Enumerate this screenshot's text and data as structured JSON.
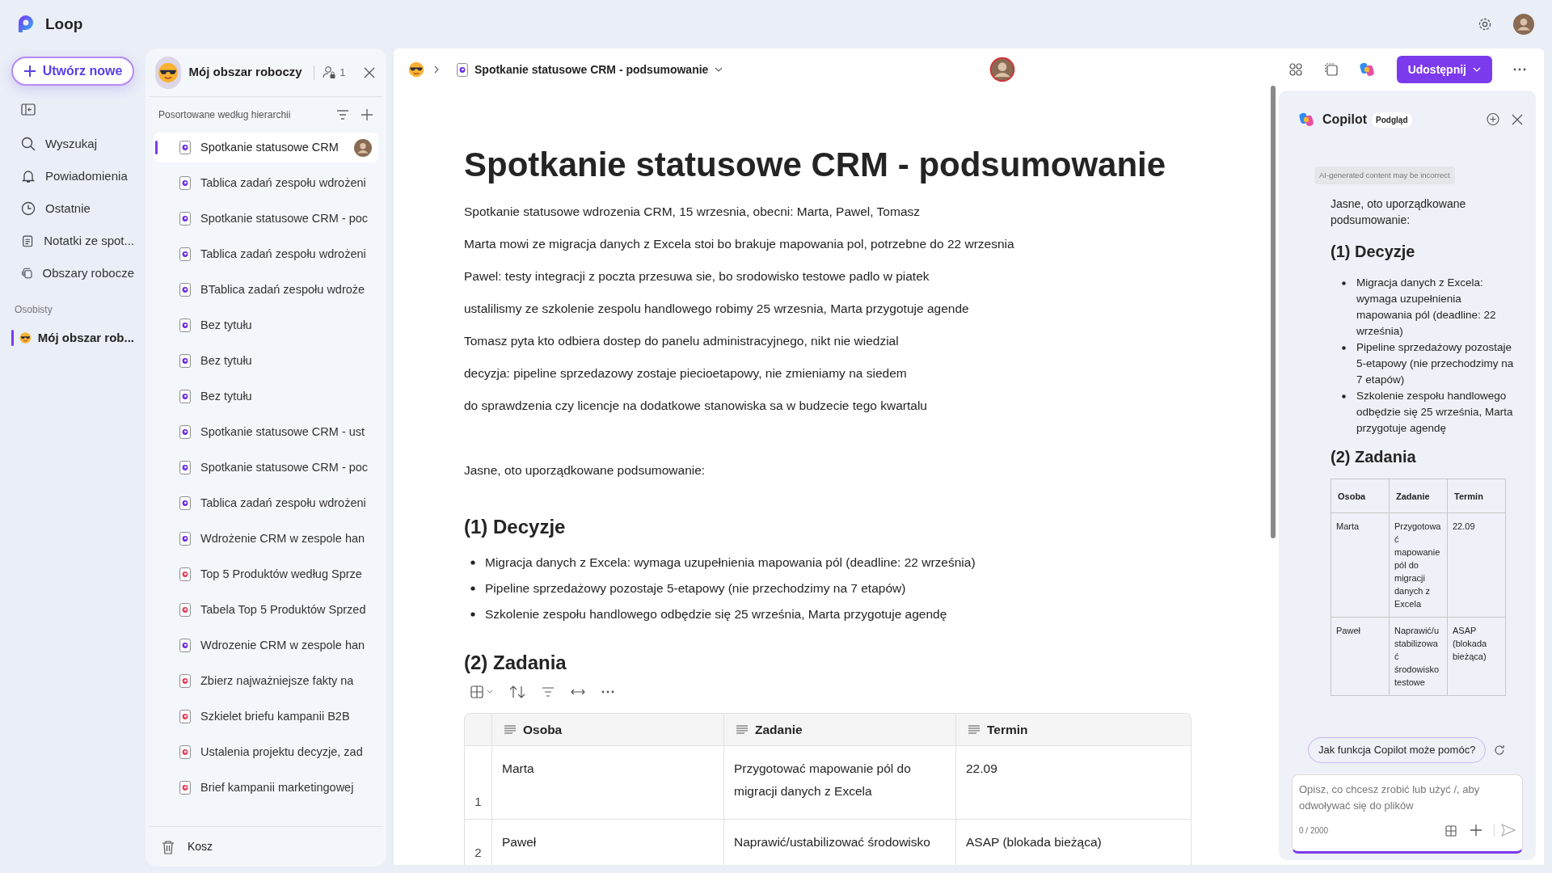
{
  "app": {
    "name": "Loop"
  },
  "create_button": "Utwórz nowe",
  "nav": [
    {
      "label": "Wyszukaj",
      "kind": "search"
    },
    {
      "label": "Powiadomienia",
      "kind": "bell"
    },
    {
      "label": "Ostatnie",
      "kind": "clock"
    },
    {
      "label": "Notatki ze spot...",
      "kind": "notes"
    },
    {
      "label": "Obszary robocze",
      "kind": "workspaces"
    }
  ],
  "section_label": "Osobisty",
  "workspaces": [
    {
      "label": "Mój obszar rob...",
      "selected": true
    }
  ],
  "sidebar": {
    "title": "Mój obszar roboczy",
    "member_count": "1",
    "sort_label": "Posortowane według hierarchii",
    "trash": "Kosz",
    "items": [
      {
        "label": "Spotkanie statusowe CRM",
        "kind": "loop",
        "selected": true
      },
      {
        "label": "Tablica zadań zespołu wdrożeni",
        "kind": "loop",
        "selected": false
      },
      {
        "label": "Spotkanie statusowe CRM - poc",
        "kind": "loop",
        "selected": false
      },
      {
        "label": "Tablica zadań zespołu wdrożeni",
        "kind": "loop",
        "selected": false
      },
      {
        "label": "BTablica zadań zespołu wdroże",
        "kind": "loop",
        "selected": false
      },
      {
        "label": "Bez tytułu",
        "kind": "loop",
        "selected": false
      },
      {
        "label": "Bez tytułu",
        "kind": "loop",
        "selected": false
      },
      {
        "label": "Bez tytułu",
        "kind": "loop",
        "selected": false
      },
      {
        "label": "Spotkanie statusowe CRM - ust",
        "kind": "loop",
        "selected": false
      },
      {
        "label": "Spotkanie statusowe CRM - poc",
        "kind": "loop",
        "selected": false
      },
      {
        "label": "Tablica zadań zespołu wdrożeni",
        "kind": "loop",
        "selected": false
      },
      {
        "label": "Wdrożenie CRM w zespole han",
        "kind": "loop",
        "selected": false
      },
      {
        "label": "Top 5 Produktów według Sprze",
        "kind": "page",
        "selected": false
      },
      {
        "label": "Tabela Top 5 Produktów Sprzed",
        "kind": "page",
        "selected": false
      },
      {
        "label": "Wdrozenie CRM w zespole han",
        "kind": "loop",
        "selected": false
      },
      {
        "label": "Zbierz najważniejsze fakty na",
        "kind": "page",
        "selected": false
      },
      {
        "label": "Szkielet briefu kampanii B2B",
        "kind": "page",
        "selected": false
      },
      {
        "label": "Ustalenia projektu decyzje, zad",
        "kind": "page",
        "selected": false
      },
      {
        "label": "Brief kampanii marketingowej",
        "kind": "page",
        "selected": false
      }
    ]
  },
  "document": {
    "breadcrumb": "Spotkanie statusowe CRM - podsumowanie",
    "share_button": "Udostępnij",
    "title": "Spotkanie statusowe CRM - podsumowanie",
    "paragraphs": [
      "Spotkanie statusowe wdrozenia CRM, 15 wrzesnia, obecni: Marta, Pawel, Tomasz",
      "Marta mowi ze migracja danych z Excela stoi bo brakuje mapowania pol, potrzebne do 22 wrzesnia",
      "Pawel: testy integracji z poczta przesuwa sie, bo srodowisko testowe padlo w piatek",
      "ustalilismy ze szkolenie zespolu handlowego robimy 25 wrzesnia, Marta przygotuje agende",
      "Tomasz pyta kto odbiera dostep do panelu administracyjnego, nikt nie wiedzial",
      "decyzja: pipeline sprzedazowy zostaje piecioetapowy, nie zmieniamy na siedem",
      "do sprawdzenia czy licencje na dodatkowe stanowiska sa w budzecie tego kwartalu"
    ],
    "summary_intro": "Jasne, oto uporządkowane podsumowanie:",
    "decisions": {
      "heading": "(1) Decyzje",
      "bullets": [
        "Migracja danych z Excela: wymaga uzupełnienia mapowania pól (deadline: 22 września)",
        "Pipeline sprzedażowy pozostaje 5-etapowy (nie przechodzimy na 7 etapów)",
        "Szkolenie zespołu handlowego odbędzie się 25 września, Marta przygotuje agendę"
      ]
    },
    "tasks": {
      "heading": "(2) Zadania",
      "columns": [
        "Osoba",
        "Zadanie",
        "Termin"
      ],
      "rows": [
        {
          "number": "1",
          "cells": [
            "Marta",
            "Przygotować mapowanie pól do migracji danych z Excela",
            "22.09"
          ]
        },
        {
          "number": "2",
          "cells": [
            "Paweł",
            "Naprawić/ustabilizować środowisko",
            "ASAP (blokada bieżąca)"
          ]
        }
      ]
    }
  },
  "copilot": {
    "title": "Copilot",
    "badge": "Podgląd",
    "disclaimer": "AI-generated content may be incorrect",
    "intro": "Jasne, oto uporządkowane podsumowanie:",
    "decisions": {
      "heading": "(1) Decyzje",
      "bullets": [
        "Migracja danych z Excela: wymaga uzupełnienia mapowania pól (deadline: 22 września)",
        "Pipeline sprzedażowy pozostaje 5-etapowy (nie przechodzimy na 7 etapów)",
        "Szkolenie zespołu handlowego odbędzie się 25 września, Marta przygotuje agendę"
      ]
    },
    "tasks": {
      "heading": "(2) Zadania",
      "columns": [
        "Osoba",
        "Zadanie",
        "Termin"
      ],
      "rows": [
        [
          "Marta",
          "Przygotować mapowanie pól do migracji danych z Excela",
          "22.09"
        ],
        [
          "Paweł",
          "Naprawić/ustabilizować środowisko testowe",
          "ASAP (blokada bieżąca)"
        ]
      ]
    },
    "suggestion": "Jak funkcja Copilot może pomóc?",
    "input": {
      "placeholder": "Opisz, co chcesz zrobić lub użyć /, aby odwoływać się do plików",
      "counter": "0 / 2000"
    }
  }
}
